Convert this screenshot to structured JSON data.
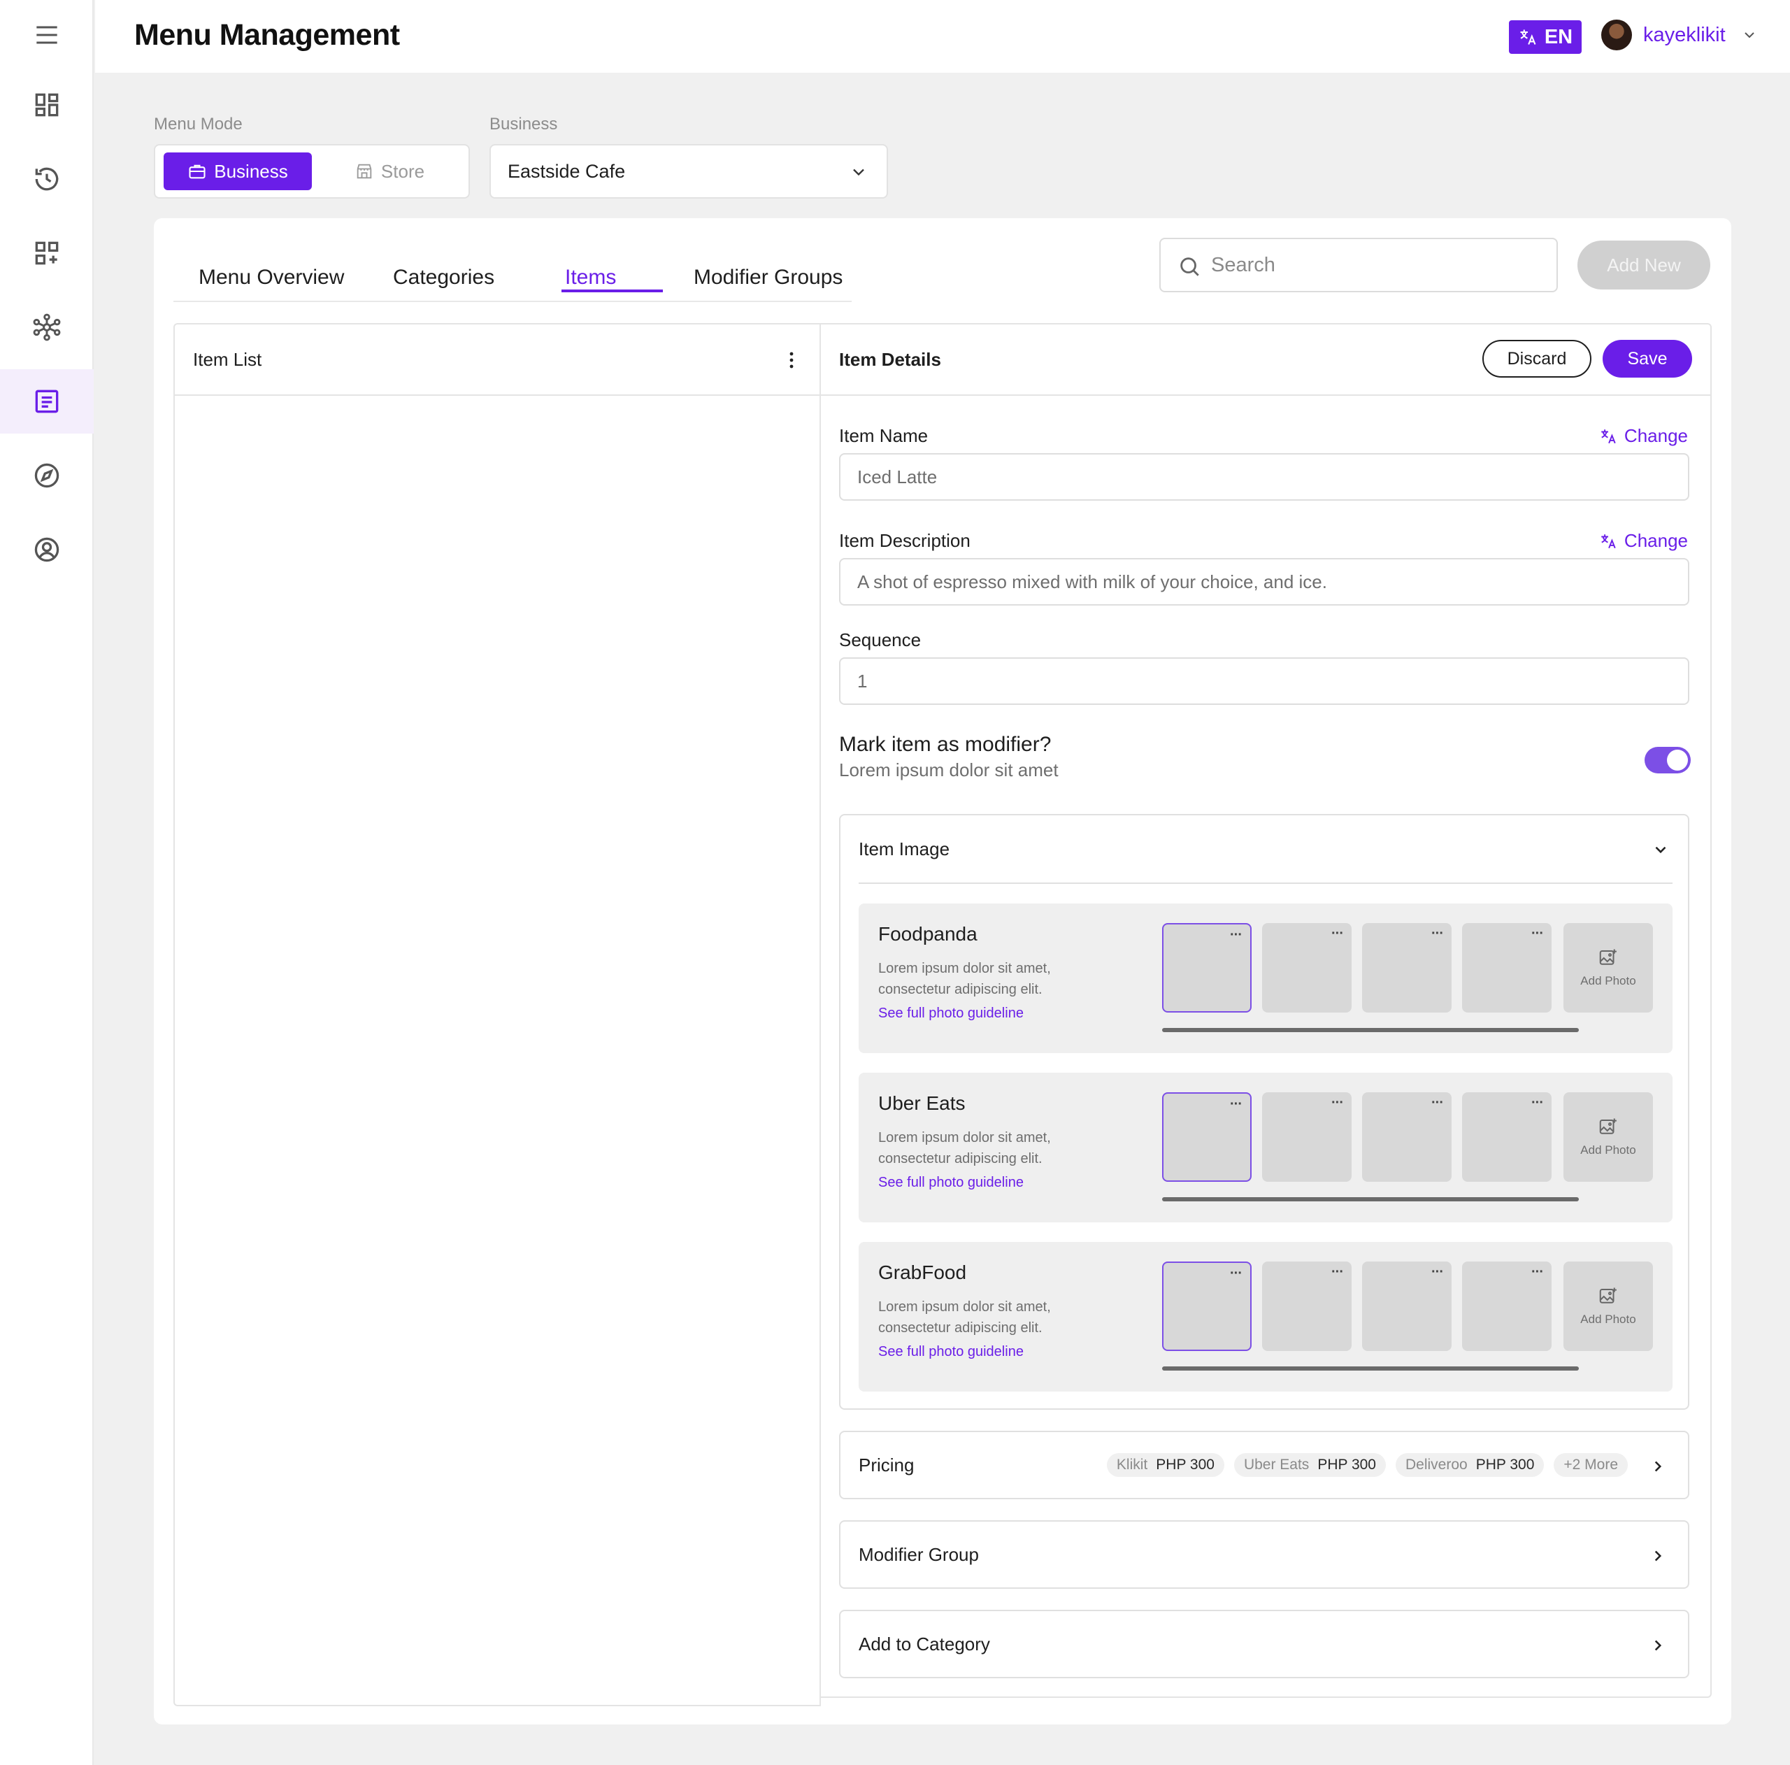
{
  "header": {
    "title": "Menu Management",
    "language": "EN",
    "username": "kayeklikit"
  },
  "sidebar": {
    "items": [
      {
        "name": "menu-icon"
      },
      {
        "name": "dashboard-icon"
      },
      {
        "name": "history-icon"
      },
      {
        "name": "add-widget-icon"
      },
      {
        "name": "network-icon"
      },
      {
        "name": "menu-list-icon",
        "active": true
      },
      {
        "name": "compass-icon"
      },
      {
        "name": "account-icon"
      }
    ]
  },
  "filters": {
    "menu_mode_label": "Menu Mode",
    "mode_business": "Business",
    "mode_store": "Store",
    "business_label": "Business",
    "business_value": "Eastside Cafe"
  },
  "tabs": {
    "overview": "Menu Overview",
    "categories": "Categories",
    "items": "Items",
    "modifier_groups": "Modifier Groups",
    "active": "Items"
  },
  "search": {
    "placeholder": "Search"
  },
  "add_new": "Add New",
  "item_list": {
    "title": "Item List"
  },
  "details": {
    "title": "Item Details",
    "discard": "Discard",
    "save": "Save",
    "name_label": "Item Name",
    "name_value": "Iced Latte",
    "change": "Change",
    "desc_label": "Item Description",
    "desc_value": "A shot of espresso mixed with milk of your choice, and ice.",
    "sequence_label": "Sequence",
    "sequence_value": "1",
    "modifier_question": "Mark item as modifier?",
    "modifier_sub": "Lorem ipsum dolor sit amet",
    "modifier_on": true
  },
  "item_image": {
    "title": "Item Image",
    "add_photo": "Add Photo",
    "platforms": [
      {
        "name": "Foodpanda",
        "desc": "Lorem ipsum dolor sit amet, consectetur adipiscing elit.",
        "link": "See full photo guideline"
      },
      {
        "name": "Uber Eats",
        "desc": "Lorem ipsum dolor sit amet, consectetur adipiscing elit.",
        "link": "See full photo guideline"
      },
      {
        "name": "GrabFood",
        "desc": "Lorem ipsum dolor sit amet, consectetur adipiscing elit.",
        "link": "See full photo guideline"
      }
    ],
    "thumb_menu": "···"
  },
  "pricing": {
    "title": "Pricing",
    "chips": [
      {
        "platform": "Klikit",
        "price": "PHP 300"
      },
      {
        "platform": "Uber Eats",
        "price": "PHP 300"
      },
      {
        "platform": "Deliveroo",
        "price": "PHP 300"
      }
    ],
    "more": "+2 More"
  },
  "modifier_group": {
    "title": "Modifier Group"
  },
  "add_to_category": {
    "title": "Add to Category"
  },
  "colors": {
    "accent": "#6a1ee8",
    "toggle": "#7c4fe6"
  }
}
